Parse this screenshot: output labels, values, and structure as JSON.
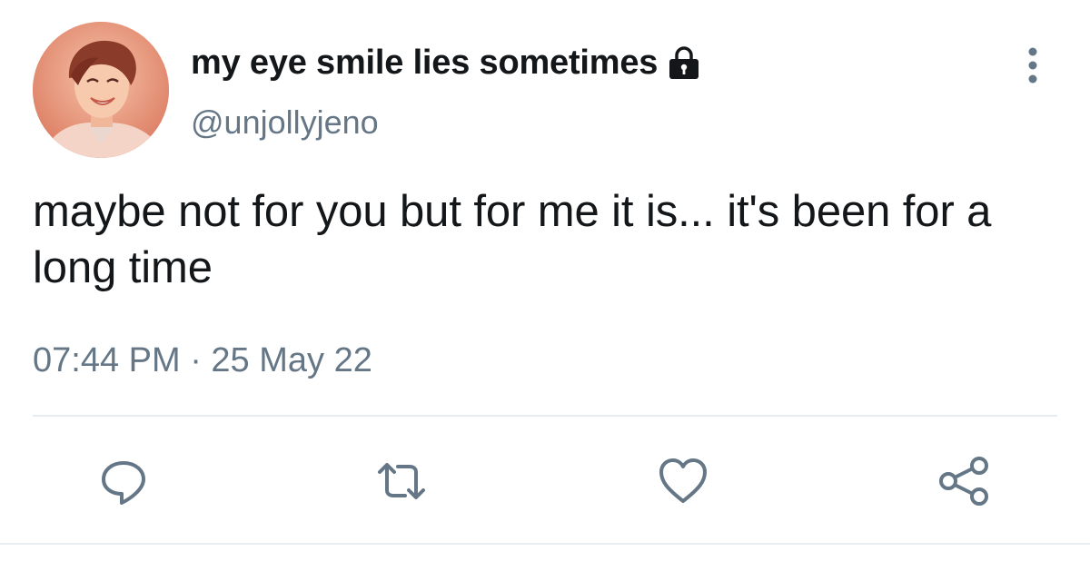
{
  "tweet": {
    "display_name": "my eye smile lies sometimes",
    "handle": "@unjollyjeno",
    "protected_icon": "lock-icon",
    "text": "maybe not for you but for me it is... it's been for a long time",
    "timestamp": "07:44 PM · 25 May 22"
  },
  "actions": [
    {
      "name": "reply",
      "icon": "reply-icon"
    },
    {
      "name": "retweet",
      "icon": "retweet-icon"
    },
    {
      "name": "like",
      "icon": "heart-icon"
    },
    {
      "name": "share",
      "icon": "share-icon"
    }
  ],
  "colors": {
    "text_primary": "#14171a",
    "text_secondary": "#657786",
    "icon": "#657786",
    "divider": "#e6ecf0",
    "avatar_tint": "#e9a184"
  }
}
